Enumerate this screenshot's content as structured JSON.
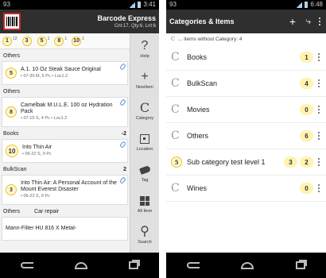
{
  "left": {
    "status": {
      "time_left": "93",
      "time_right": "3:41"
    },
    "actionbar": {
      "title": "Barcode Express",
      "subtitle": "Cnt:17, Qty:6, Lnt:6"
    },
    "qty_chips": [
      {
        "value": "1",
        "sup": "12"
      },
      {
        "value": "3",
        "sup": ""
      },
      {
        "value": "5",
        "sup": "1"
      },
      {
        "value": "8",
        "sup": "1"
      },
      {
        "value": "10",
        "sup": "1"
      }
    ],
    "groups": [
      {
        "name": "Others",
        "count": "",
        "items": [
          {
            "badge": "5",
            "title": "A.1. 10 Oz Steak Sauce Original",
            "meta": "• 07-30 M, 5 Pc • Loc1.2"
          }
        ]
      },
      {
        "name": "Others",
        "count": "",
        "items": [
          {
            "badge": "8",
            "title": "Camelbak M.U.L.E. 100 oz Hydration Pack",
            "meta": "• 07-15 S, 4 Pc • Loc1.2"
          }
        ]
      },
      {
        "name": "Books",
        "count": "-2",
        "items": [
          {
            "badge": "10",
            "title": "Into Thin Air",
            "meta": "• 06-22 S, 9 Pc"
          }
        ]
      },
      {
        "name": "BulkScan",
        "count": "2",
        "items": [
          {
            "badge": "3",
            "title": "Into Thin Air: A Personal Account of the Mount Everest Disaster",
            "meta": "• 06-22 S, 9 Pc"
          }
        ]
      },
      {
        "name": "Others",
        "count": "Car repair",
        "items": [
          {
            "badge": "",
            "title": "Mann-Filter HU 816 X Metal-",
            "meta": ""
          }
        ]
      }
    ],
    "tools": [
      {
        "icon": "help-icon",
        "glyph": "?",
        "label": "Help"
      },
      {
        "icon": "plus-icon",
        "glyph": "+",
        "label": "NewItem"
      },
      {
        "icon": "category-icon",
        "glyph": "C",
        "label": "Category"
      },
      {
        "icon": "location-icon",
        "glyph": "",
        "label": "Location"
      },
      {
        "icon": "tag-icon",
        "glyph": "",
        "label": "Tag"
      },
      {
        "icon": "all-items-icon",
        "glyph": "",
        "label": "All Item"
      },
      {
        "icon": "search-icon",
        "glyph": "⚲",
        "label": "Search"
      }
    ]
  },
  "right": {
    "status": {
      "time_left": "93",
      "time_right": "6:48"
    },
    "actionbar": {
      "title": "Categories & Items"
    },
    "hint": "... items without Category: 4",
    "hint_glyph": "C",
    "categories": [
      {
        "glyph": "C",
        "label": "Books",
        "badge": "1",
        "left_badge": ""
      },
      {
        "glyph": "C",
        "label": "BulkScan",
        "badge": "4",
        "left_badge": ""
      },
      {
        "glyph": "C",
        "label": "Movies",
        "badge": "0",
        "left_badge": ""
      },
      {
        "glyph": "C",
        "label": "Others",
        "badge": "6",
        "left_badge": ""
      },
      {
        "glyph": "",
        "label": "Sub category test level 1",
        "badge": "2",
        "left_badge": "5",
        "mid_badge": "3"
      },
      {
        "glyph": "C",
        "label": "Wines",
        "badge": "0",
        "left_badge": ""
      }
    ]
  }
}
